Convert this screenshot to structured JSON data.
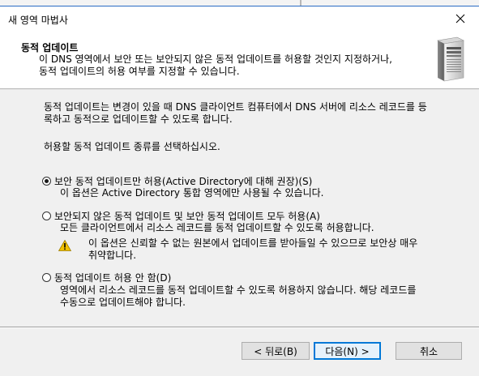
{
  "dialog": {
    "title": "새 영역 마법사",
    "close_glyph": "✕"
  },
  "header": {
    "title": "동적 업데이트",
    "description_line1": "이 DNS 영역에서 보안 또는 보안되지 않은 동적 업데이트를 허용할 것인지 지정하거나,",
    "description_line2": "동적 업데이트의 허용 여부를 지정할 수 있습니다.",
    "icon": "server-icon"
  },
  "body": {
    "intro_line1": "동적 업데이트는 변경이 있을 때 DNS 클라이언트 컴퓨터에서 DNS 서버에 리소스 레코드를 등",
    "intro_line2": "록하고 동적으로 업데이트할 수 있도록 합니다.",
    "prompt": "허용할 동적 업데이트 종류를 선택하십시오.",
    "options": [
      {
        "label": "보안 동적 업데이트만 허용(Active Directory에 대해 권장)(S)",
        "description": "이 옵션은 Active Directory 통합 영역에만 사용될 수 있습니다.",
        "checked": true
      },
      {
        "label": "보안되지 않은 동적 업데이트 및 보안 동적 업데이트 모두 허용(A)",
        "description": "모든 클라이언트에서 리소스 레코드를 동적 업데이트할 수 있도록 허용합니다.",
        "checked": false
      },
      {
        "label": "동적 업데이트 허용 안 함(D)",
        "description_line1": "영역에서 리소스 레코드를 동적 업데이트할 수 있도록 허용하지 않습니다. 해당 레코드를",
        "description_line2": "수동으로 업데이트해야 합니다.",
        "checked": false
      }
    ],
    "warning_line1": "이 옵션은 신뢰할 수 없는 원본에서 업데이트를 받아들일 수 있으므로 보안상 매우",
    "warning_line2": "취약합니다.",
    "warning_icon": "warning-icon"
  },
  "buttons": {
    "back": "< 뒤로(B)",
    "next": "다음(N) >",
    "cancel": "취소"
  },
  "colors": {
    "accent": "#0078d7",
    "warning": "#f2c200"
  }
}
